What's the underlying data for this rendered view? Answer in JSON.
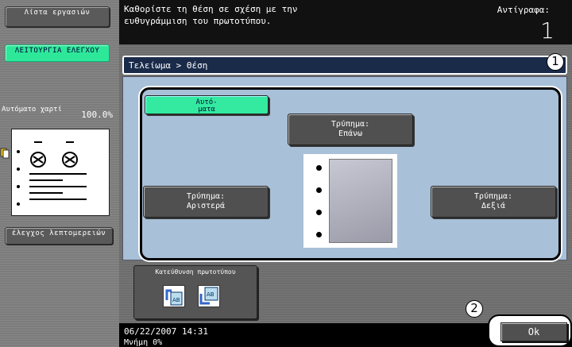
{
  "sidebar": {
    "job_list_label": "Λίστα εργασιών",
    "check_function_label": "ΛΕΙΤΟΥΡΓΙΑ ΕΛΕΓΧΟΥ",
    "auto_paper_label": "Αυτόματο χαρτί",
    "zoom_value": "100.0%",
    "check_details_label": "έλεγχος λεπτομερειών"
  },
  "header": {
    "message": "Καθορίστε τη θέση σε σχέση με την ευθυγράμμιση του πρωτοτύπου.",
    "copies_label": "Αντίγραφα:",
    "copies_value": "1"
  },
  "breadcrumb": "Τελείωμα > Θέση",
  "positions": {
    "auto": "Αυτό-ματα",
    "top": "Τρύπημα: Επάνω",
    "left": "Τρύπημα: Αριστερά",
    "right": "Τρύπημα: Δεξιά"
  },
  "orientation_label": "Κατεύθυνση πρωτοτύπου",
  "status": {
    "datetime": "06/22/2007   14:31",
    "memory": "Μνήμη        0%"
  },
  "ok_label": "Ok",
  "callouts": [
    "1",
    "2"
  ]
}
